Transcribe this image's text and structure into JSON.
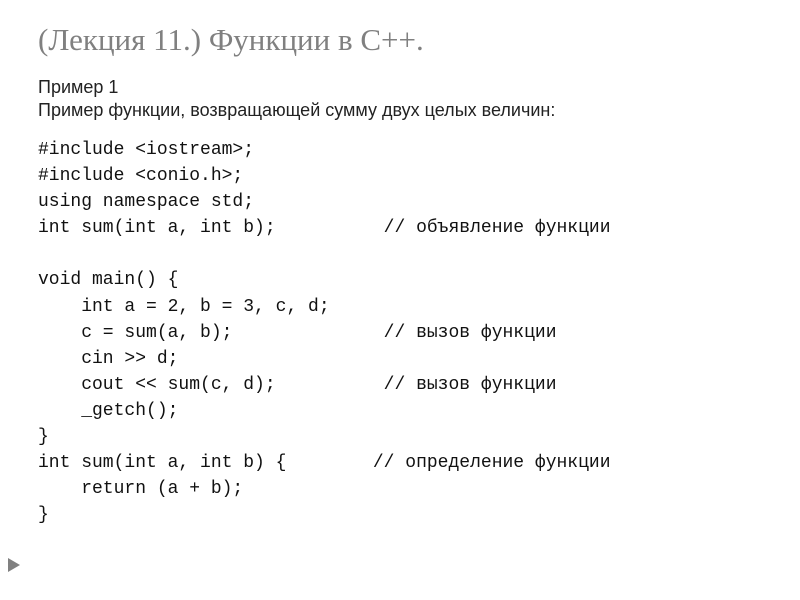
{
  "title": "(Лекция 11.) Функции в С++.",
  "example_label": "Пример 1",
  "example_desc": "Пример функции, возвращающей сумму двух целых величин:",
  "code": {
    "l1": "#include <iostream>;",
    "l2": "#include <conio.h>;",
    "l3": "using namespace std;",
    "l4a": "int sum(int a, int b);",
    "l4b": "// объявление функции",
    "l5": "",
    "l6": "void main() {",
    "l7": "    int a = 2, b = 3, c, d;",
    "l8a": "    c = sum(a, b);",
    "l8b": "// вызов функции",
    "l9": "    cin >> d;",
    "l10a": "    cout << sum(c, d);",
    "l10b": "// вызов функции",
    "l11": "    _getch();",
    "l12": "}",
    "l13a": "int sum(int a, int b) {",
    "l13b": "// определение функции",
    "l14": "    return (a + b);",
    "l15": "}"
  }
}
